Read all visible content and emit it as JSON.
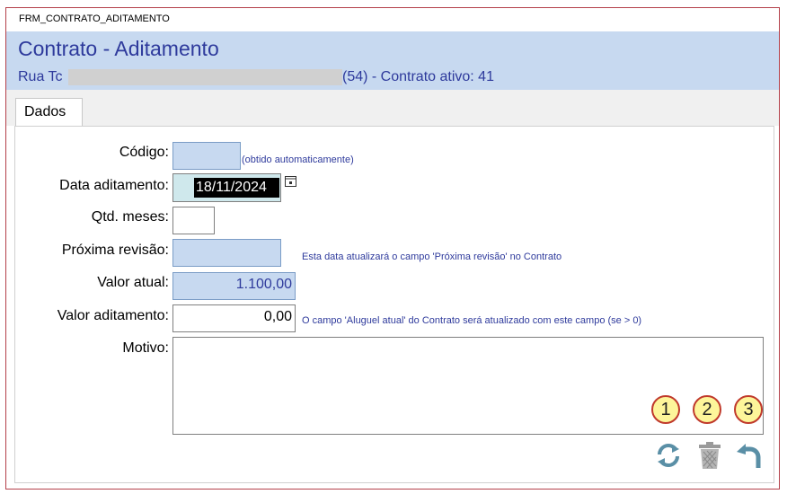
{
  "window": {
    "caption": "FRM_CONTRATO_ADITAMENTO"
  },
  "header": {
    "title": "Contrato - Aditamento",
    "sub_left": "Rua Tc",
    "sub_right": "(54) - Contrato ativo: 41"
  },
  "tabs": [
    {
      "label": "Dados"
    }
  ],
  "form": {
    "codigo": {
      "label": "Código:",
      "value": "",
      "note": "(obtido automaticamente)"
    },
    "data_aditamento": {
      "label": "Data aditamento:",
      "value": "18/11/2024"
    },
    "qtd_meses": {
      "label": "Qtd. meses:",
      "value": ""
    },
    "proxima_revisao": {
      "label": "Próxima revisão:",
      "value": "",
      "note": "Esta data atualizará o campo 'Próxima revisão' no Contrato"
    },
    "valor_atual": {
      "label": "Valor atual:",
      "value": "1.100,00"
    },
    "valor_aditamento": {
      "label": "Valor aditamento:",
      "value": "0,00",
      "note": "O campo 'Aluguel atual' do Contrato será atualizado com este campo (se > 0)"
    },
    "motivo": {
      "label": "Motivo:",
      "value": ""
    }
  },
  "actions": [
    {
      "badge": "1",
      "icon": "refresh-icon"
    },
    {
      "badge": "2",
      "icon": "trash-icon"
    },
    {
      "badge": "3",
      "icon": "undo-icon"
    }
  ],
  "colors": {
    "header_bg": "#c7d9f0",
    "title_text": "#2e3a9c",
    "border": "#b4404a",
    "badge_bg": "#fdf59a"
  }
}
